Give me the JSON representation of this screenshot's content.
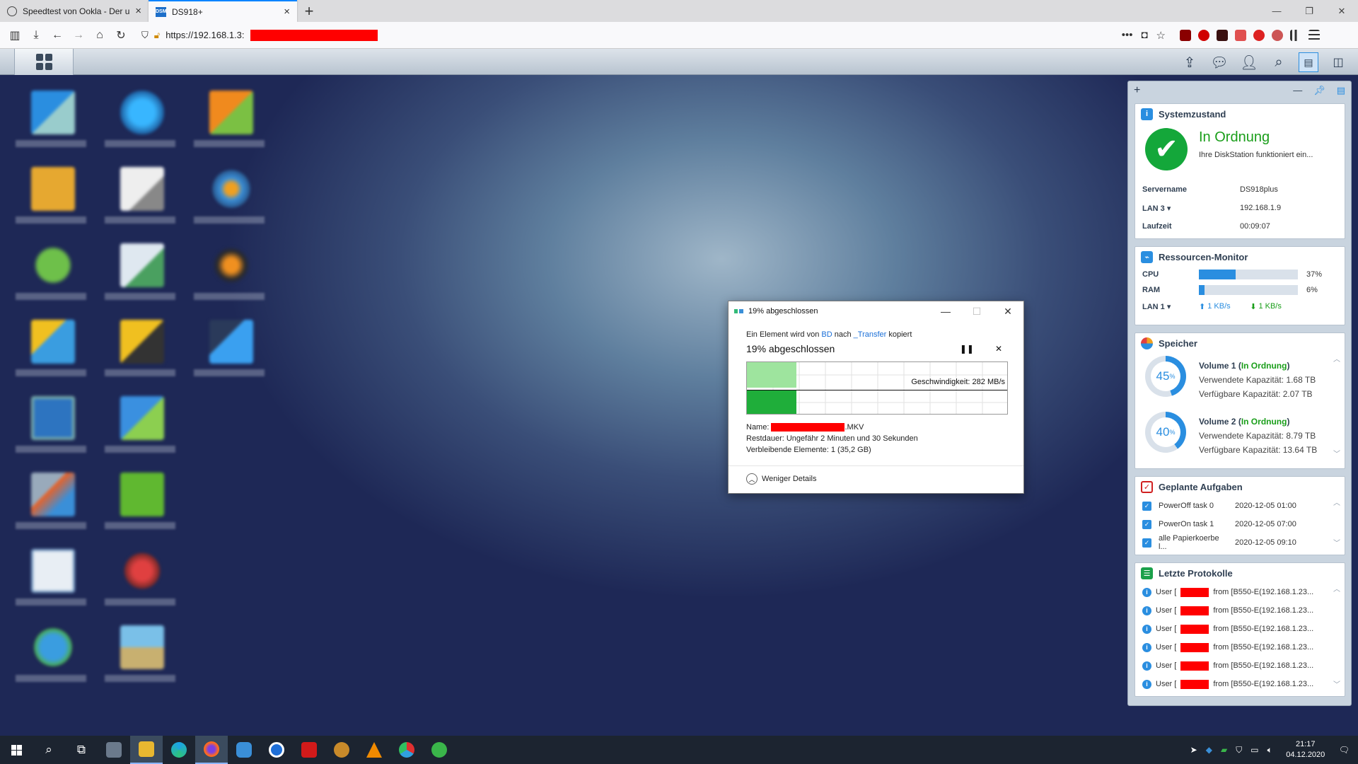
{
  "browser": {
    "tabs": [
      {
        "title": "Speedtest von Ookla - Der umf",
        "active": false
      },
      {
        "title": "DS918+",
        "active": true
      }
    ],
    "url": "https://192.168.1.3:"
  },
  "widgets": {
    "system": {
      "title": "Systemzustand",
      "status": "In Ordnung",
      "status_desc": "Ihre DiskStation funktioniert ein...",
      "rows": [
        {
          "key": "Servername",
          "value": "DS918plus"
        },
        {
          "key": "LAN 3 ▾",
          "value": "192.168.1.9"
        },
        {
          "key": "Laufzeit",
          "value": "00:09:07"
        }
      ]
    },
    "resource": {
      "title": "Ressourcen-Monitor",
      "cpu_label": "CPU",
      "cpu_value": "37%",
      "cpu_pct": 37,
      "ram_label": "RAM",
      "ram_value": "6%",
      "ram_pct": 6,
      "lan_label": "LAN 1 ▾",
      "upload": "1 KB/s",
      "download": "1 KB/s"
    },
    "storage": {
      "title": "Speicher",
      "volumes": [
        {
          "name": "Volume 1",
          "status": "In Ordnung",
          "pct_label": "45",
          "pct": 45,
          "used": "Verwendete Kapazität: 1.68 TB",
          "free": "Verfügbare Kapazität: 2.07 TB"
        },
        {
          "name": "Volume 2",
          "status": "In Ordnung",
          "pct_label": "40",
          "pct": 40,
          "used": "Verwendete Kapazität: 8.79 TB",
          "free": "Verfügbare Kapazität: 13.64 TB"
        }
      ]
    },
    "tasks": {
      "title": "Geplante Aufgaben",
      "items": [
        {
          "name": "PowerOff task 0",
          "time": "2020-12-05 01:00"
        },
        {
          "name": "PowerOn task 1",
          "time": "2020-12-05 07:00"
        },
        {
          "name": "alle Papierkoerbe l...",
          "time": "2020-12-05 09:10"
        }
      ]
    },
    "logs": {
      "title": "Letzte Protokolle",
      "prefix": "User [",
      "suffix": "from [B550-E(192.168.1.23...",
      "count": 6
    }
  },
  "dialog": {
    "title": "19% abgeschlossen",
    "line_pre": "Ein Element wird von ",
    "source": "BD",
    "line_mid": " nach ",
    "dest": "_Transfer",
    "line_post": " kopiert",
    "percent_text": "19% abgeschlossen",
    "speed": "Geschwindigkeit: 282 MB/s",
    "name_label": "Name: ",
    "name_ext": ".MKV",
    "remaining": "Restdauer: Ungefähr 2 Minuten und 30 Sekunden",
    "items_left": "Verbleibende Elemente: 1 (35,2 GB)",
    "less_details": "Weniger Details"
  },
  "taskbar": {
    "time": "21:17",
    "date": "04.12.2020"
  }
}
